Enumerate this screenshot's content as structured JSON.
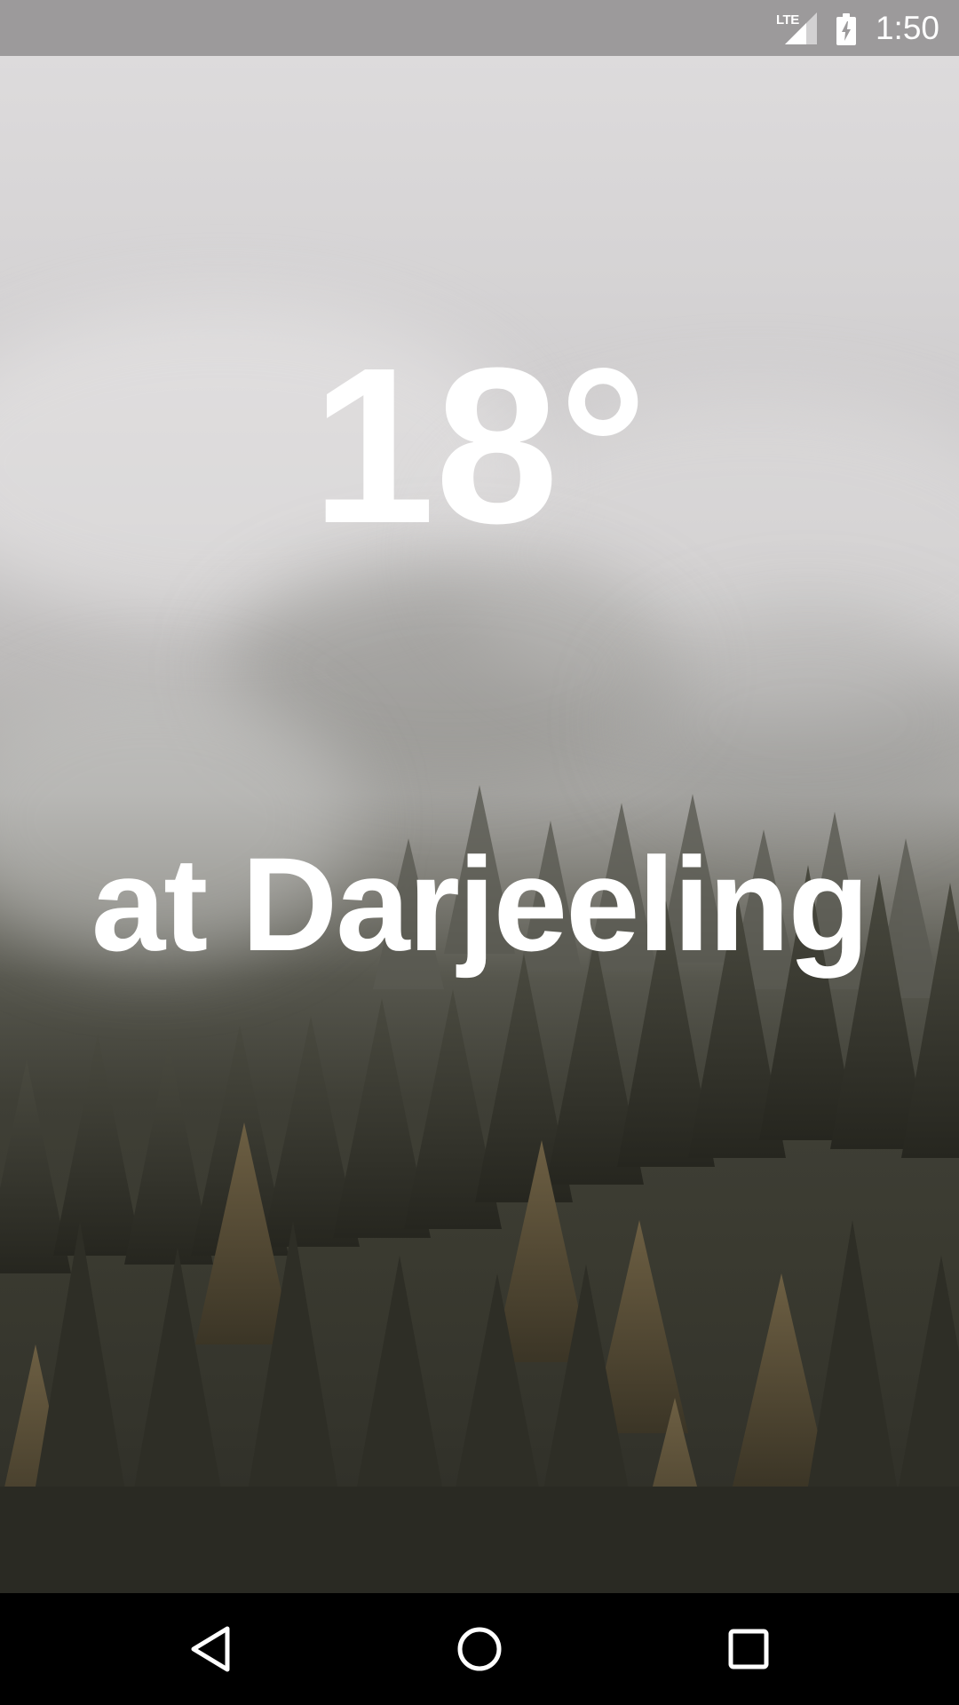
{
  "status_bar": {
    "network_label": "LTE",
    "time": "1:50",
    "icons": [
      "lte-signal-icon",
      "battery-charging-icon"
    ]
  },
  "weather": {
    "temperature": "18°",
    "location_text": "at Darjeeling"
  },
  "nav_bar": {
    "icons": [
      "back-triangle-icon",
      "home-circle-icon",
      "recents-square-icon"
    ]
  },
  "colors": {
    "status_bar_bg": "#9c9a9b",
    "nav_bar_bg": "#000000",
    "text": "#ffffff"
  }
}
